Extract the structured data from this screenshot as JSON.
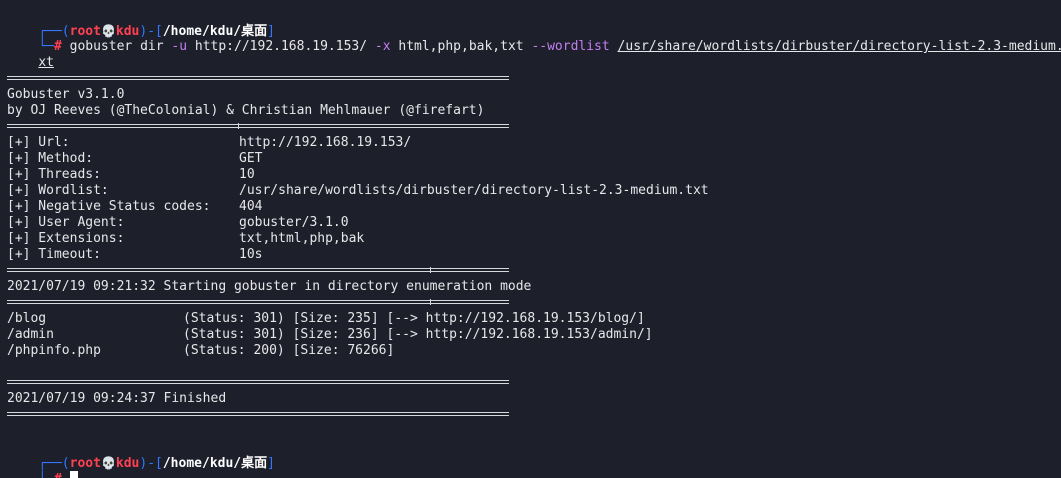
{
  "prompt": {
    "corner_top": "┌──(",
    "user": "root",
    "skull": "💀",
    "host": "kdu",
    "mid": ")-[",
    "path": "/home/kdu/桌面",
    "close": "]",
    "corner_bottom": "└─",
    "hash": "#"
  },
  "command": {
    "binary": "gobuster",
    "sub": " dir ",
    "flag_u": "-u",
    "url": " http://192.168.19.153/ ",
    "flag_x": "-x",
    "exts": " html,php,bak,txt ",
    "flag_w": "--wordlist",
    "space": " ",
    "wordlist_part1": "/usr/share/wordlists/dirbuster/directory-list-2.3-medium.t",
    "wordlist_part2": "xt"
  },
  "banner": {
    "title": "Gobuster v3.1.0",
    "authors": "by OJ Reeves (@TheColonial) & Christian Mehlmauer (@firefart)"
  },
  "config": [
    {
      "key": "[+] Url:",
      "value": "http://192.168.19.153/"
    },
    {
      "key": "[+] Method:",
      "value": "GET"
    },
    {
      "key": "[+] Threads:",
      "value": "10"
    },
    {
      "key": "[+] Wordlist:",
      "value": "/usr/share/wordlists/dirbuster/directory-list-2.3-medium.txt"
    },
    {
      "key": "[+] Negative Status codes:",
      "value": "404"
    },
    {
      "key": "[+] User Agent:",
      "value": "gobuster/3.1.0"
    },
    {
      "key": "[+] Extensions:",
      "value": "txt,html,php,bak"
    },
    {
      "key": "[+] Timeout:",
      "value": "10s"
    }
  ],
  "start_msg": "2021/07/19 09:21:32 Starting gobuster in directory enumeration mode",
  "results": [
    {
      "path": "/blog",
      "info": "(Status: 301) [Size: 235] [--> http://192.168.19.153/blog/]"
    },
    {
      "path": "/admin",
      "info": "(Status: 301) [Size: 236] [--> http://192.168.19.153/admin/]"
    },
    {
      "path": "/phpinfo.php",
      "info": "(Status: 200) [Size: 76266]"
    }
  ],
  "finish_msg": "2021/07/19 09:24:37 Finished",
  "colors": {
    "background": "#1d1f2a",
    "prompt_blue": "#2f78ff",
    "prompt_red": "#ff4152",
    "flag_purple": "#c47ef2",
    "text": "#e7e7ea"
  }
}
